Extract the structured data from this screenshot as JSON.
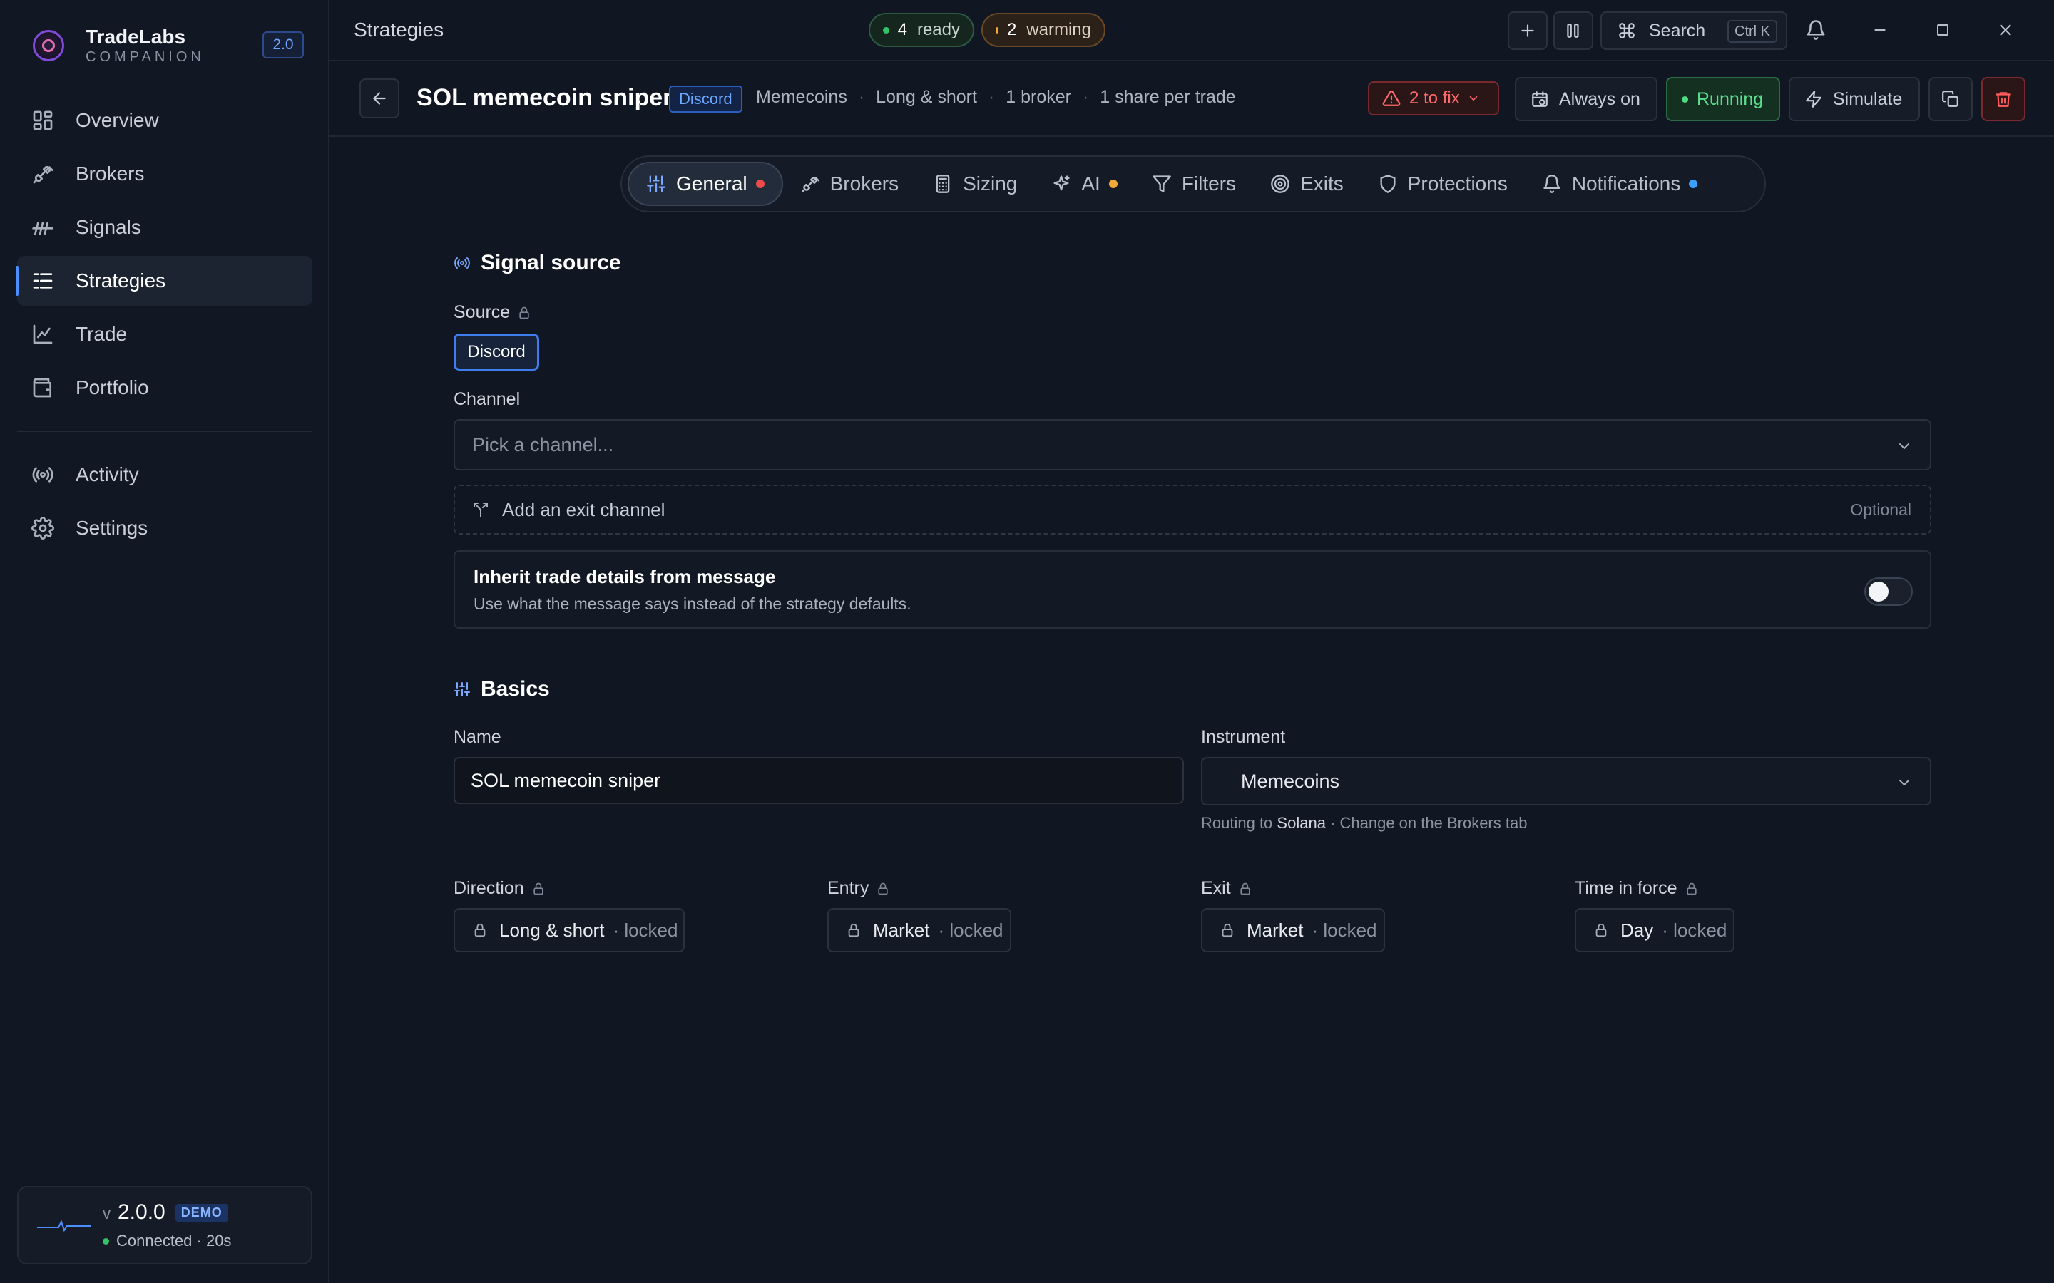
{
  "app": {
    "name": "TradeLabs",
    "subtitle": "COMPANION",
    "version_badge": "2.0"
  },
  "sidebar": {
    "items": [
      {
        "label": "Overview",
        "icon": "grid-icon"
      },
      {
        "label": "Brokers",
        "icon": "plug-icon"
      },
      {
        "label": "Signals",
        "icon": "signals-icon"
      },
      {
        "label": "Strategies",
        "icon": "list-icon",
        "active": true
      },
      {
        "label": "Trade",
        "icon": "chart-icon"
      },
      {
        "label": "Portfolio",
        "icon": "wallet-icon"
      }
    ],
    "secondary": [
      {
        "label": "Activity",
        "icon": "broadcast-icon"
      },
      {
        "label": "Settings",
        "icon": "gear-icon"
      }
    ],
    "status": {
      "v_prefix": "v",
      "version": "2.0.0",
      "badge": "DEMO",
      "connection": "Connected · 20s"
    }
  },
  "topbar": {
    "breadcrumb": "Strategies",
    "ready_count": "4",
    "ready_label": "ready",
    "warming_count": "2",
    "warming_label": "warming",
    "search_label": "Search",
    "search_shortcut": "Ctrl K"
  },
  "strategy": {
    "title": "SOL memecoin sniper",
    "source_badge": "Discord",
    "meta": [
      "Memecoins",
      "Long & short",
      "1 broker",
      "1 share per trade"
    ],
    "fix_label": "2 to fix",
    "schedule_label": "Always on",
    "status_label": "Running",
    "simulate_label": "Simulate"
  },
  "tabs": [
    {
      "label": "General",
      "icon": "sliders-icon",
      "active": true,
      "dot": "red"
    },
    {
      "label": "Brokers",
      "icon": "plug-icon"
    },
    {
      "label": "Sizing",
      "icon": "calculator-icon"
    },
    {
      "label": "AI",
      "icon": "sparkle-icon",
      "dot": "amber"
    },
    {
      "label": "Filters",
      "icon": "filter-icon"
    },
    {
      "label": "Exits",
      "icon": "target-icon"
    },
    {
      "label": "Protections",
      "icon": "shield-icon"
    },
    {
      "label": "Notifications",
      "icon": "bell-icon",
      "dot": "blue"
    }
  ],
  "signal_source": {
    "title": "Signal source",
    "source_label": "Source",
    "source_value": "Discord",
    "channel_label": "Channel",
    "channel_placeholder": "Pick a channel...",
    "exit_channel_label": "Add an exit channel",
    "exit_channel_optional": "Optional",
    "inherit_title": "Inherit trade details from message",
    "inherit_desc": "Use what the message says instead of the strategy defaults.",
    "inherit_enabled": false
  },
  "basics": {
    "title": "Basics",
    "name_label": "Name",
    "name_value": "SOL memecoin sniper",
    "instrument_label": "Instrument",
    "instrument_value": "Memecoins",
    "routing_prefix": "Routing to",
    "routing_target": "Solana",
    "routing_suffix": "· Change on the Brokers tab",
    "locked_fields": [
      {
        "label": "Direction",
        "value": "Long & short",
        "suffix": "· locked"
      },
      {
        "label": "Entry",
        "value": "Market",
        "suffix": "· locked"
      },
      {
        "label": "Exit",
        "value": "Market",
        "suffix": "· locked"
      },
      {
        "label": "Time in force",
        "value": "Day",
        "suffix": "· locked"
      }
    ]
  },
  "colors": {
    "accent": "#4c8dff",
    "danger": "#ff5d5d",
    "success": "#5be08f",
    "warning": "#f1a93a"
  }
}
